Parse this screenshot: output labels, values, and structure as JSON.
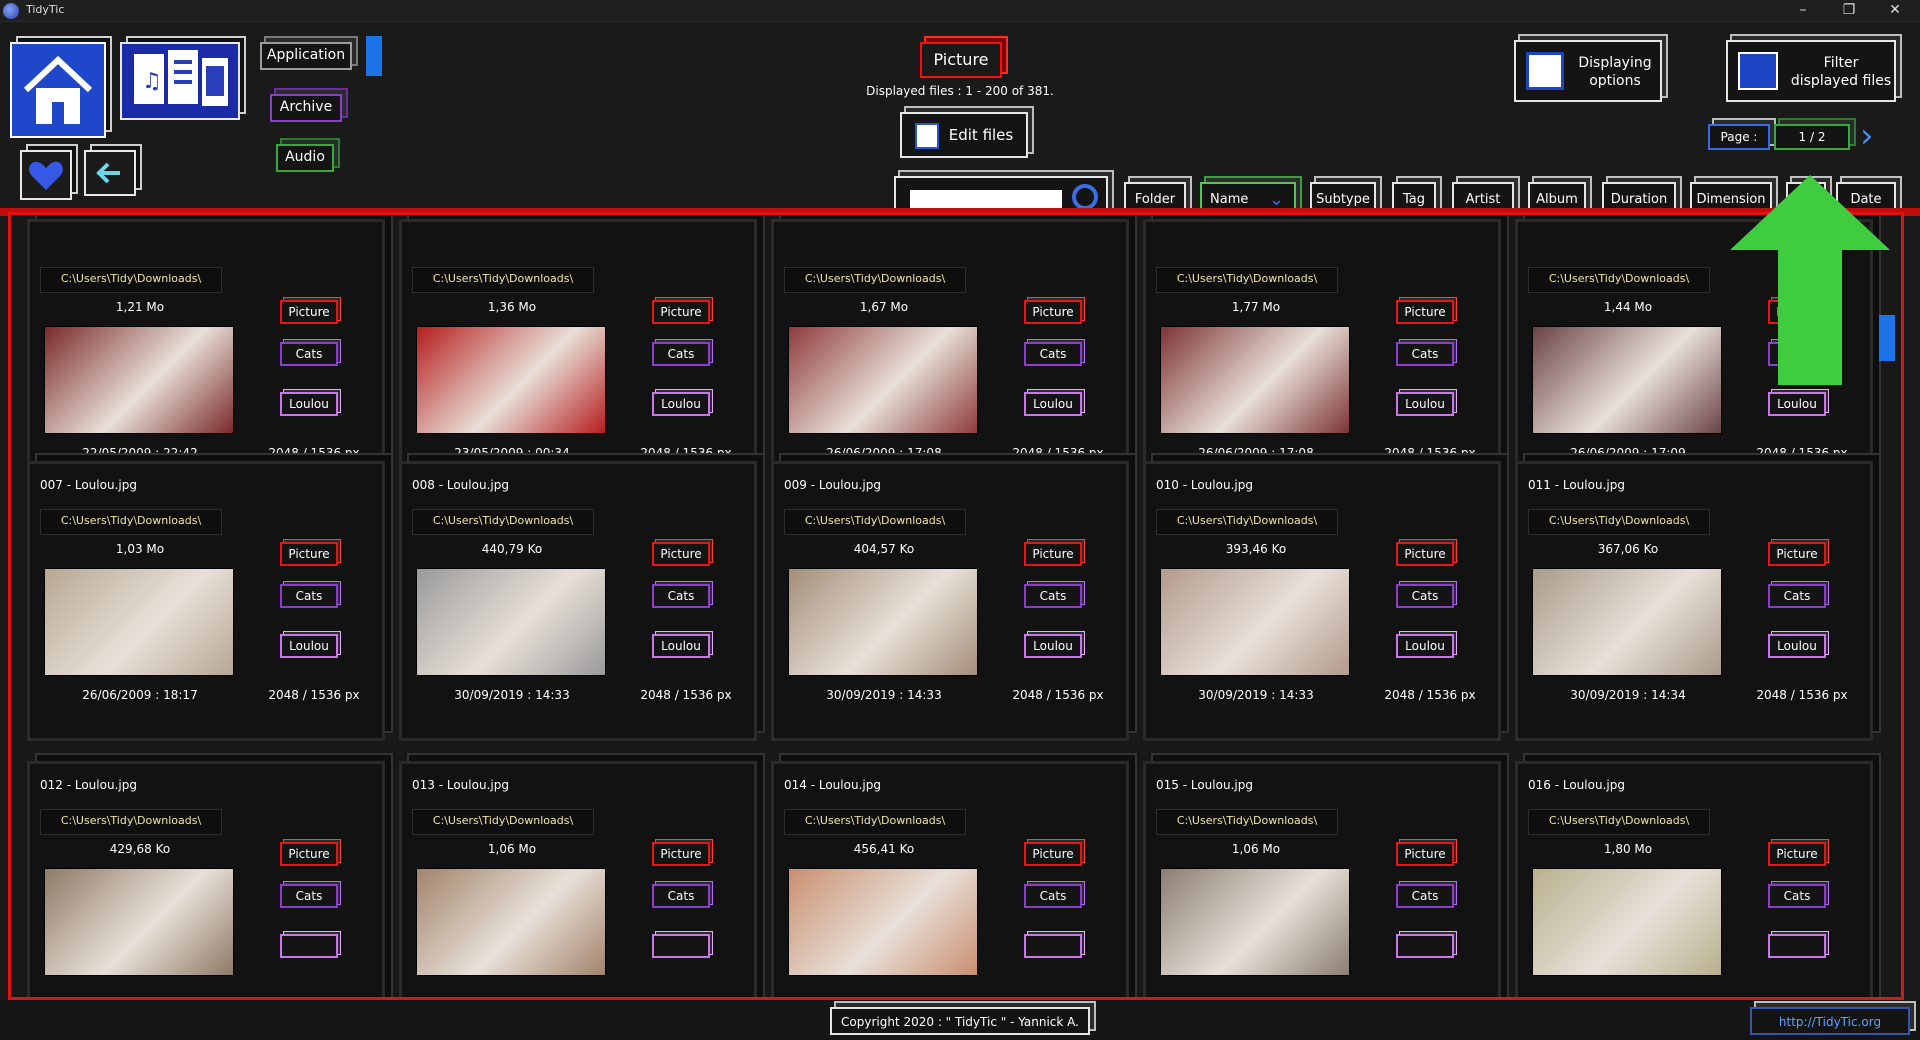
{
  "window": {
    "title": "TidyTic",
    "minimize": "–",
    "restore": "❐",
    "close": "✕"
  },
  "nav": {
    "home_icon": "home-icon",
    "media_icon": "media-files-icon",
    "favorite_icon": "heart-icon",
    "back_icon": "back-arrow-icon",
    "types": [
      "Application",
      "Archive",
      "Audio"
    ]
  },
  "header": {
    "current_type": "Picture",
    "displayed_info": "Displayed files : 1 - 200 of 381.",
    "edit_files": "Edit files",
    "displaying_options": "Displaying options",
    "filter_files": "Filter displayed files",
    "page_label": "Page :",
    "page_value": "1 / 2"
  },
  "search": {
    "placeholder": ""
  },
  "sort_columns": [
    "Folder",
    "Name",
    "Subtype",
    "Tag",
    "Artist",
    "Album",
    "Duration",
    "Dimension",
    "Size",
    "Date"
  ],
  "active_sort": "Name",
  "cards": [
    {
      "name": "",
      "path": "C:\\Users\\Tidy\\Downloads\\",
      "size": "1,21 Mo",
      "date": "22/05/2009 : 22:42",
      "dims": "2048 / 1536 px",
      "type": "Picture",
      "tag1": "Cats",
      "tag2": "Loulou",
      "thumb": "#7a2a28"
    },
    {
      "name": "",
      "path": "C:\\Users\\Tidy\\Downloads\\",
      "size": "1,36 Mo",
      "date": "23/05/2009 : 00:34",
      "dims": "2048 / 1536 px",
      "type": "Picture",
      "tag1": "Cats",
      "tag2": "Loulou",
      "thumb": "#b51e1e"
    },
    {
      "name": "",
      "path": "C:\\Users\\Tidy\\Downloads\\",
      "size": "1,67 Mo",
      "date": "26/06/2009 : 17:08",
      "dims": "2048 / 1536 px",
      "type": "Picture",
      "tag1": "Cats",
      "tag2": "Loulou",
      "thumb": "#8e3b3b"
    },
    {
      "name": "",
      "path": "C:\\Users\\Tidy\\Downloads\\",
      "size": "1,77 Mo",
      "date": "26/06/2009 : 17:08",
      "dims": "2048 / 1536 px",
      "type": "Picture",
      "tag1": "Cats",
      "tag2": "Loulou",
      "thumb": "#7d3434"
    },
    {
      "name": "",
      "path": "C:\\Users\\Tidy\\Downloads\\",
      "size": "1,44 Mo",
      "date": "26/06/2009 : 17:09",
      "dims": "2048 / 1536 px",
      "type": "Picture",
      "tag1": "Cats",
      "tag2": "Loulou",
      "thumb": "#6b4444"
    },
    {
      "name": "007 - Loulou.jpg",
      "path": "C:\\Users\\Tidy\\Downloads\\",
      "size": "1,03 Mo",
      "date": "26/06/2009 : 18:17",
      "dims": "2048 / 1536 px",
      "type": "Picture",
      "tag1": "Cats",
      "tag2": "Loulou",
      "thumb": "#b6a792"
    },
    {
      "name": "008 - Loulou.jpg",
      "path": "C:\\Users\\Tidy\\Downloads\\",
      "size": "440,79 Ko",
      "date": "30/09/2019 : 14:33",
      "dims": "2048 / 1536 px",
      "type": "Picture",
      "tag1": "Cats",
      "tag2": "Loulou",
      "thumb": "#9a9a9a"
    },
    {
      "name": "009 - Loulou.jpg",
      "path": "C:\\Users\\Tidy\\Downloads\\",
      "size": "404,57 Ko",
      "date": "30/09/2019 : 14:33",
      "dims": "2048 / 1536 px",
      "type": "Picture",
      "tag1": "Cats",
      "tag2": "Loulou",
      "thumb": "#a48e78"
    },
    {
      "name": "010 - Loulou.jpg",
      "path": "C:\\Users\\Tidy\\Downloads\\",
      "size": "393,46 Ko",
      "date": "30/09/2019 : 14:33",
      "dims": "2048 / 1536 px",
      "type": "Picture",
      "tag1": "Cats",
      "tag2": "Loulou",
      "thumb": "#b39a8c"
    },
    {
      "name": "011 - Loulou.jpg",
      "path": "C:\\Users\\Tidy\\Downloads\\",
      "size": "367,06 Ko",
      "date": "30/09/2019 : 14:34",
      "dims": "2048 / 1536 px",
      "type": "Picture",
      "tag1": "Cats",
      "tag2": "Loulou",
      "thumb": "#a89b8a"
    },
    {
      "name": "012 - Loulou.jpg",
      "path": "C:\\Users\\Tidy\\Downloads\\",
      "size": "429,68 Ko",
      "date": "",
      "dims": "",
      "type": "Picture",
      "tag1": "Cats",
      "tag2": "",
      "thumb": "#8f7a66"
    },
    {
      "name": "013 - Loulou.jpg",
      "path": "C:\\Users\\Tidy\\Downloads\\",
      "size": "1,06 Mo",
      "date": "",
      "dims": "",
      "type": "Picture",
      "tag1": "Cats",
      "tag2": "",
      "thumb": "#a2846a"
    },
    {
      "name": "014 - Loulou.jpg",
      "path": "C:\\Users\\Tidy\\Downloads\\",
      "size": "456,41 Ko",
      "date": "",
      "dims": "",
      "type": "Picture",
      "tag1": "Cats",
      "tag2": "",
      "thumb": "#c98f70"
    },
    {
      "name": "015 - Loulou.jpg",
      "path": "C:\\Users\\Tidy\\Downloads\\",
      "size": "1,06 Mo",
      "date": "",
      "dims": "",
      "type": "Picture",
      "tag1": "Cats",
      "tag2": "",
      "thumb": "#8b7e72"
    },
    {
      "name": "016 - Loulou.jpg",
      "path": "C:\\Users\\Tidy\\Downloads\\",
      "size": "1,80 Mo",
      "date": "",
      "dims": "",
      "type": "Picture",
      "tag1": "Cats",
      "tag2": "",
      "thumb": "#b8b08c"
    }
  ],
  "footer": {
    "copyright": "Copyright 2020 : \" TidyTic \" - Yannick A.",
    "site": "http://TidyTic.org"
  },
  "colors": {
    "accent_red": "#e31212",
    "accent_blue": "#1e73e8",
    "accent_green": "#39c63e",
    "path_text": "#f0e5a6"
  }
}
